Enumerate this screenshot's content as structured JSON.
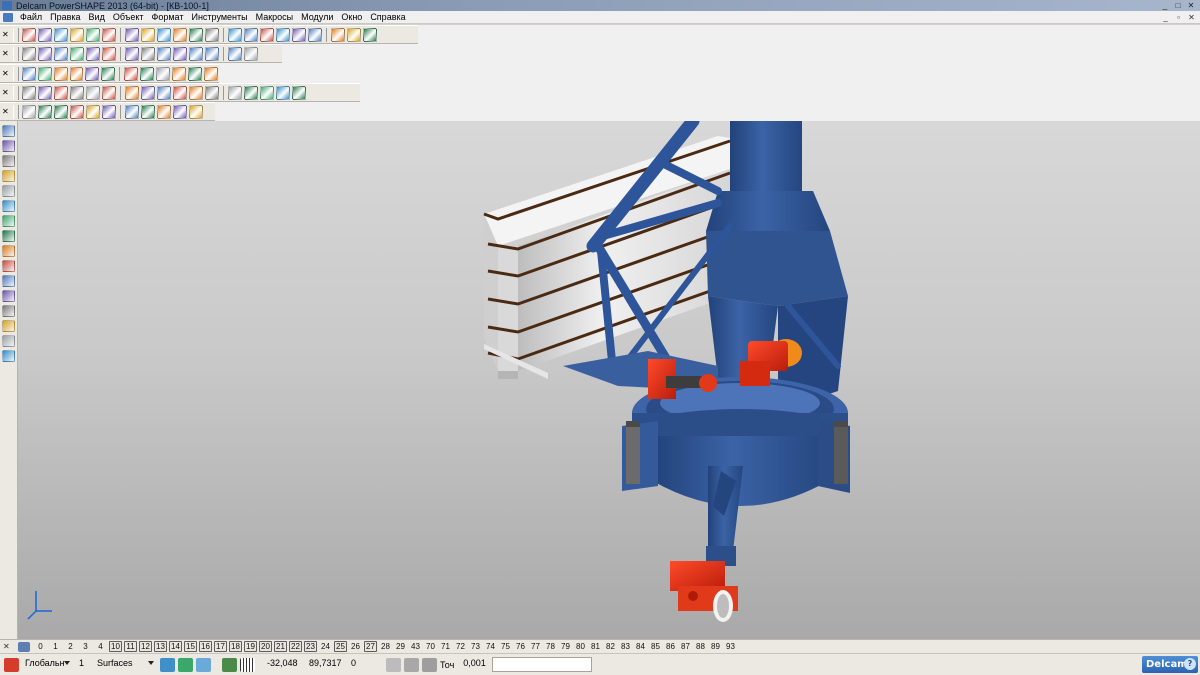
{
  "window": {
    "title": "Delcam PowerSHAPE 2013 (64-bit) - [КВ-100-1]",
    "controls": [
      "minimize-icon",
      "maximize-icon",
      "close-icon"
    ]
  },
  "menu": {
    "items": [
      "Файл",
      "Правка",
      "Вид",
      "Объект",
      "Формат",
      "Инструменты",
      "Макросы",
      "Модули",
      "Окно",
      "Справка"
    ]
  },
  "toolbars": {
    "row1_icons": [
      "new-file-icon",
      "open-file-icon",
      "save-icon",
      "save-as-icon",
      "print-icon",
      "cut-icon",
      "copy-icon",
      "paste-icon",
      "delete-icon",
      "undo-icon",
      "redo-icon",
      "select-icon",
      "move-icon",
      "rotate-icon",
      "circle-icon",
      "curve-icon",
      "wrap-icon",
      "snap-icon",
      "measure-icon",
      "wireframe-icon",
      "tool-icon"
    ],
    "row2_icons": [
      "view-iso1-icon",
      "view-iso2-icon",
      "view-iso3-icon",
      "view-top-icon",
      "view-front-icon",
      "pan-icon",
      "zoom-icon",
      "zoom-fit-icon",
      "zoom-window-icon",
      "globe-icon",
      "shade-icon",
      "shaded-edges-icon",
      "lightbulb-icon",
      "hand-icon"
    ],
    "row3_icons": [
      "sheet-icon",
      "calc-icon",
      "layer-icon",
      "green-sphere-icon",
      "red-sphere-icon",
      "green-tri-icon",
      "yellow-tri-icon",
      "box-icon",
      "copy-view-icon",
      "tree-icon",
      "info-icon",
      "move-obj-icon"
    ],
    "row4_icons": [
      "solid-box-icon",
      "solid-cyl-icon",
      "solid-sphere-icon",
      "solid-cone-icon",
      "solid-torus-icon",
      "solid-extrude-icon",
      "solid-revolve-icon",
      "solid-sweep-icon",
      "boolean-add-icon",
      "boolean-sub-icon",
      "boolean-int-icon",
      "fillet-icon",
      "chamfer-icon",
      "shell-icon",
      "draft-icon",
      "split-icon",
      "mirror-icon"
    ],
    "row5_icons": [
      "surface-plane-icon",
      "surface-xyz-icon",
      "assembly-icon",
      "component-icon",
      "mate-icon",
      "explode-icon",
      "animate-icon",
      "bom-icon",
      "drawing-icon",
      "check-icon",
      "render-icon"
    ]
  },
  "left_toolbar": {
    "icons": [
      "select-arrow-icon",
      "sketch-icon",
      "divider-icon",
      "warning-icon",
      "cut-icon",
      "solid-icon",
      "surface-icon",
      "trim-icon",
      "flip-icon",
      "star-icon",
      "mirror-icon",
      "arrow-icon",
      "globe-icon",
      "cube-icon",
      "text-icon",
      "red-cube-icon"
    ]
  },
  "levels": {
    "items": [
      {
        "label": "0",
        "on": false
      },
      {
        "label": "1",
        "on": false
      },
      {
        "label": "2",
        "on": false
      },
      {
        "label": "3",
        "on": false
      },
      {
        "label": "4",
        "on": false
      },
      {
        "label": "10",
        "on": true
      },
      {
        "label": "11",
        "on": true
      },
      {
        "label": "12",
        "on": true
      },
      {
        "label": "13",
        "on": true
      },
      {
        "label": "14",
        "on": true
      },
      {
        "label": "15",
        "on": true
      },
      {
        "label": "16",
        "on": true
      },
      {
        "label": "17",
        "on": true
      },
      {
        "label": "18",
        "on": true
      },
      {
        "label": "19",
        "on": true
      },
      {
        "label": "20",
        "on": true
      },
      {
        "label": "21",
        "on": true
      },
      {
        "label": "22",
        "on": true
      },
      {
        "label": "23",
        "on": true
      },
      {
        "label": "24",
        "on": false
      },
      {
        "label": "25",
        "on": true
      },
      {
        "label": "26",
        "on": false
      },
      {
        "label": "27",
        "on": true
      },
      {
        "label": "28",
        "on": false
      },
      {
        "label": "29",
        "on": false
      },
      {
        "label": "43",
        "on": false
      },
      {
        "label": "70",
        "on": false
      },
      {
        "label": "71",
        "on": false
      },
      {
        "label": "72",
        "on": false
      },
      {
        "label": "73",
        "on": false
      },
      {
        "label": "74",
        "on": false
      },
      {
        "label": "75",
        "on": false
      },
      {
        "label": "76",
        "on": false
      },
      {
        "label": "77",
        "on": false
      },
      {
        "label": "78",
        "on": false
      },
      {
        "label": "79",
        "on": false
      },
      {
        "label": "80",
        "on": false
      },
      {
        "label": "81",
        "on": false
      },
      {
        "label": "82",
        "on": false
      },
      {
        "label": "83",
        "on": false
      },
      {
        "label": "84",
        "on": false
      },
      {
        "label": "85",
        "on": false
      },
      {
        "label": "86",
        "on": false
      },
      {
        "label": "87",
        "on": false
      },
      {
        "label": "88",
        "on": false
      },
      {
        "label": "89",
        "on": false
      },
      {
        "label": "93",
        "on": false
      }
    ]
  },
  "status": {
    "workplane": "Глобальн",
    "level_number": "1",
    "level_name": "Surfaces",
    "x": "-32,048",
    "y": "89,7317",
    "z": "0",
    "tolerance_label": "Точ",
    "tolerance_value": "0,001",
    "brand": "Delcam"
  }
}
